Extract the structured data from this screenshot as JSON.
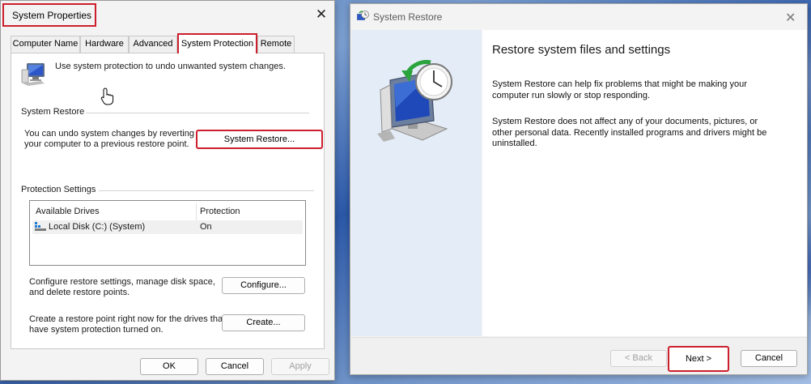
{
  "system_properties": {
    "title": "System Properties",
    "tabs": [
      {
        "label": "Computer Name"
      },
      {
        "label": "Hardware"
      },
      {
        "label": "Advanced"
      },
      {
        "label": "System Protection"
      },
      {
        "label": "Remote"
      }
    ],
    "intro_text": "Use system protection to undo unwanted system changes.",
    "system_restore": {
      "group_label": "System Restore",
      "description_line1": "You can undo system changes by reverting",
      "description_line2": "your computer to a previous restore point.",
      "button_label": "System Restore..."
    },
    "protection_settings": {
      "group_label": "Protection Settings",
      "columns": [
        "Available Drives",
        "Protection"
      ],
      "rows": [
        {
          "drive": "Local Disk (C:) (System)",
          "protection": "On"
        }
      ],
      "configure_text_line1": "Configure restore settings, manage disk space,",
      "configure_text_line2": "and delete restore points.",
      "configure_button": "Configure...",
      "create_text_line1": "Create a restore point right now for the drives that",
      "create_text_line2": "have system protection turned on.",
      "create_button": "Create..."
    },
    "footer": {
      "ok": "OK",
      "cancel": "Cancel",
      "apply": "Apply"
    }
  },
  "system_restore_wizard": {
    "title": "System Restore",
    "heading": "Restore system files and settings",
    "para1_line1": "System Restore can help fix problems that might be making your",
    "para1_line2": "computer run slowly or stop responding.",
    "para2_line1": "System Restore does not affect any of your documents, pictures, or",
    "para2_line2": "other personal data. Recently installed programs and drivers might be",
    "para2_line3": "uninstalled.",
    "footer": {
      "back": "< Back",
      "next": "Next >",
      "cancel": "Cancel"
    }
  },
  "colors": {
    "highlight_red": "#cc1f2d",
    "wizard_sidebar": "#e4ecf7",
    "window_bg": "#f3f3f3"
  }
}
